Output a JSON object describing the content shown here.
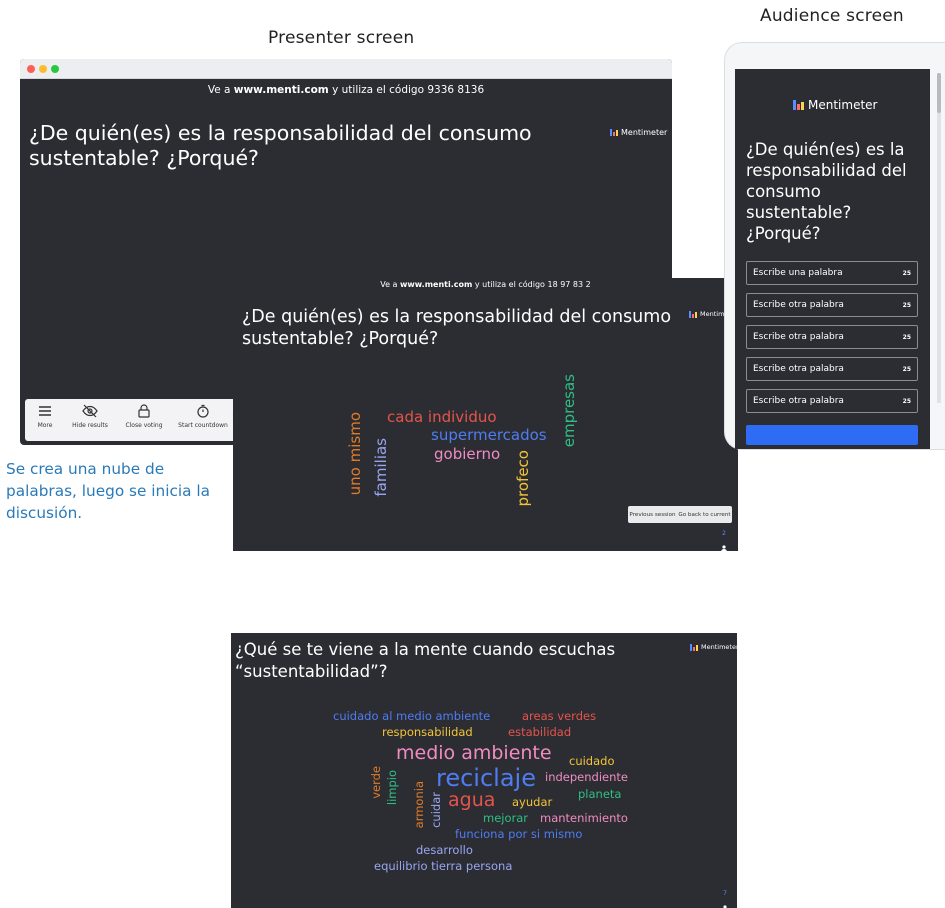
{
  "captions": {
    "presenter": "Presenter screen",
    "audience": "Audience screen"
  },
  "presenter": {
    "code_prefix": "Ve a ",
    "code_url": "www.menti.com",
    "code_mid": " y utiliza el código ",
    "code_value": "9336 8136",
    "question": "¿De quién(es) es la responsabilidad del consumo sustentable? ¿Porqué?",
    "brand": "Mentimeter",
    "toolbar": [
      {
        "label": "More",
        "icon": "menu-icon"
      },
      {
        "label": "Hide results",
        "icon": "eye-off-icon"
      },
      {
        "label": "Close voting",
        "icon": "lock-icon"
      },
      {
        "label": "Start countdown",
        "icon": "stopwatch-icon"
      }
    ],
    "toolbar_more_glyph": "›"
  },
  "cloud1": {
    "code_prefix": "Ve a ",
    "code_url": "www.menti.com",
    "code_mid": " y utiliza el código ",
    "code_value": "18 97 83 2",
    "question": "¿De quién(es) es la responsabilidad del consumo sustentable? ¿Porqué?",
    "brand": "Mentimeter",
    "words": [
      {
        "text": "cada individuo",
        "color": "#e5544b"
      },
      {
        "text": "supermercados",
        "color": "#4f7cf0"
      },
      {
        "text": "gobierno",
        "color": "#f08cc0"
      },
      {
        "text": "uno mismo",
        "color": "#e07b29"
      },
      {
        "text": "familias",
        "color": "#9aa6f0"
      },
      {
        "text": "profeco",
        "color": "#f3c437"
      },
      {
        "text": "empresas",
        "color": "#2fbf83"
      }
    ],
    "prev_session": "Previous session",
    "go_back": "Go back to current",
    "participants": "2"
  },
  "audience": {
    "brand": "Mentimeter",
    "question": "¿De quién(es) es la responsabilidad del consumo sustentable? ¿Porqué?",
    "inputs": [
      {
        "placeholder": "Escribe una palabra",
        "count": "25"
      },
      {
        "placeholder": "Escribe otra palabra",
        "count": "25"
      },
      {
        "placeholder": "Escribe otra palabra",
        "count": "25"
      },
      {
        "placeholder": "Escribe otra palabra",
        "count": "25"
      },
      {
        "placeholder": "Escribe otra palabra",
        "count": "25"
      }
    ]
  },
  "note": "Se crea una nube de palabras, luego se inicia la discusión.",
  "cloud2": {
    "question": "¿Qué se te viene a la mente cuando escuchas “sustentabilidad”?",
    "brand": "Mentimeter",
    "words": [
      {
        "text": "cuidado al medio ambiente",
        "color": "#4f7cf0"
      },
      {
        "text": "areas verdes",
        "color": "#e5544b"
      },
      {
        "text": "responsabilidad",
        "color": "#f3c437"
      },
      {
        "text": "estabilidad",
        "color": "#e5544b"
      },
      {
        "text": "medio ambiente",
        "color": "#f08cc0"
      },
      {
        "text": "cuidado",
        "color": "#f3c437"
      },
      {
        "text": "reciclaje",
        "color": "#4f7cf0"
      },
      {
        "text": "independiente",
        "color": "#f08cc0"
      },
      {
        "text": "verde",
        "color": "#e07b29"
      },
      {
        "text": "limpio",
        "color": "#2fbf83"
      },
      {
        "text": "armonia",
        "color": "#e07b29"
      },
      {
        "text": "cuidar",
        "color": "#9aa6f0"
      },
      {
        "text": "agua",
        "color": "#e5544b"
      },
      {
        "text": "ayudar",
        "color": "#f3c437"
      },
      {
        "text": "planeta",
        "color": "#2fbf83"
      },
      {
        "text": "mejorar",
        "color": "#2fbf83"
      },
      {
        "text": "mantenimiento",
        "color": "#f08cc0"
      },
      {
        "text": "funciona por si mismo",
        "color": "#4f7cf0"
      },
      {
        "text": "desarrollo",
        "color": "#9aa6f0"
      },
      {
        "text": "equilibrio tierra persona",
        "color": "#9aa6f0"
      }
    ],
    "participants": "7"
  },
  "colors": {
    "slide_bg": "#2b2d33",
    "accent_blue": "#2f6cf5",
    "note_blue": "#2a7ab8"
  }
}
